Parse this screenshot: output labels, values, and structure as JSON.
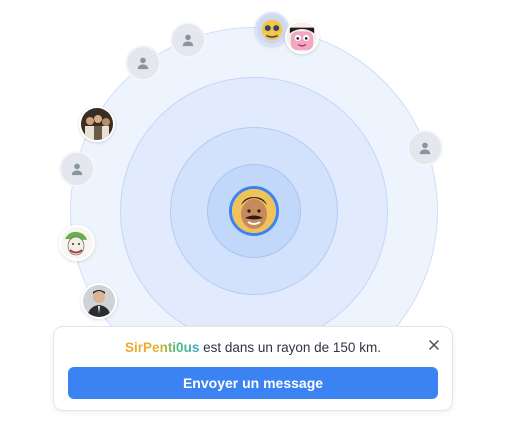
{
  "radar": {
    "center_user": {
      "avatar": "mustached-man-photo"
    },
    "nearby_users": [
      {
        "avatar": "person-placeholder-icon"
      },
      {
        "avatar": "person-placeholder-icon"
      },
      {
        "avatar": "cartoon-character-photo"
      },
      {
        "avatar": "cartoon-pink-character-photo"
      },
      {
        "avatar": "group-photo"
      },
      {
        "avatar": "person-placeholder-icon"
      },
      {
        "avatar": "person-placeholder-icon"
      },
      {
        "avatar": "joker-drawing-photo"
      },
      {
        "avatar": "suited-man-photo"
      }
    ]
  },
  "notification": {
    "username": "SirPenti0us",
    "message": " est dans un rayon de 150 km.",
    "close_icon": "close-icon",
    "button_label": "Envoyer un message"
  },
  "colors": {
    "accent": "#3b82f3",
    "ring_light": "#eef4fe",
    "ring_dark": "#c2d8fb"
  }
}
